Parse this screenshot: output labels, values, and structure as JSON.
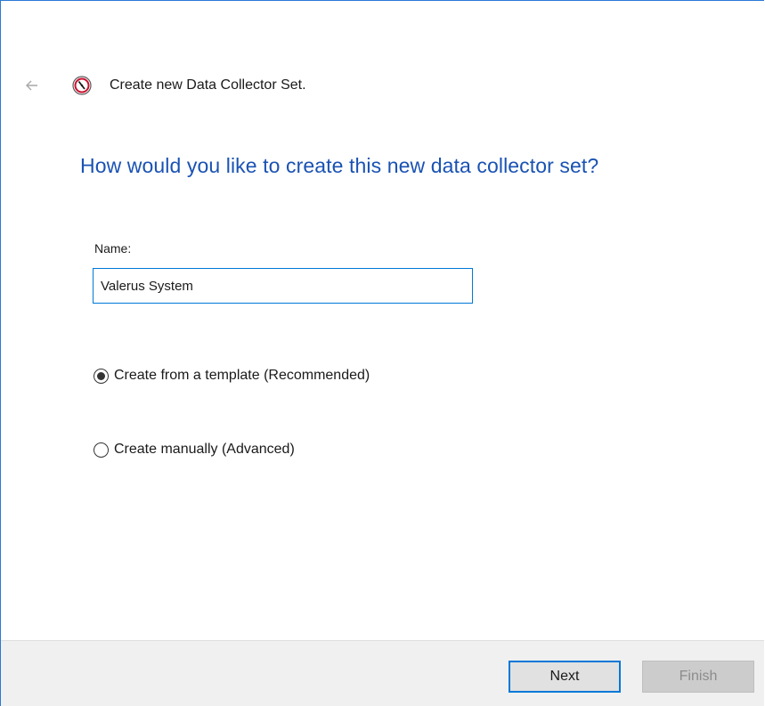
{
  "header": {
    "back_icon": "back-arrow-icon",
    "app_icon": "performance-monitor-icon",
    "title": "Create new Data Collector Set."
  },
  "main": {
    "instruction": "How would you like to create this new data collector set?",
    "name_label": "Name:",
    "name_value": "Valerus System",
    "options": [
      {
        "label": "Create from a template (Recommended)",
        "selected": true
      },
      {
        "label": "Create manually (Advanced)",
        "selected": false
      }
    ]
  },
  "footer": {
    "next_label": "Next",
    "finish_label": "Finish"
  },
  "colors": {
    "accent": "#0078d7",
    "instruction": "#1a52b3",
    "footer_bg": "#f0f0f0"
  }
}
